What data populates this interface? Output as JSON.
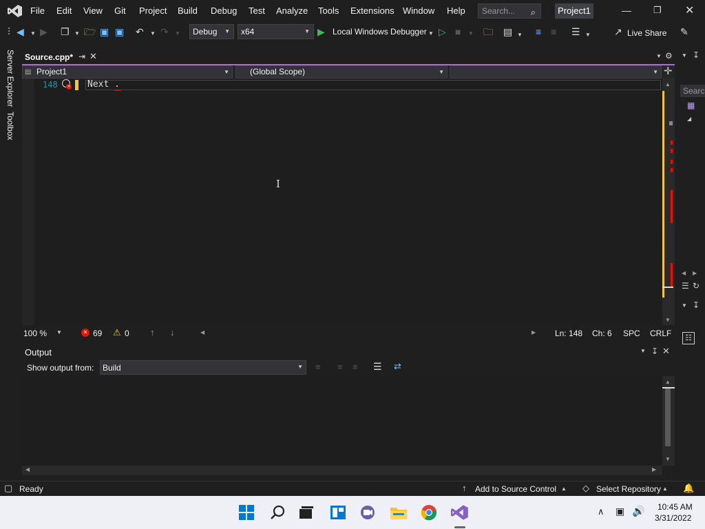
{
  "menu": [
    "File",
    "Edit",
    "View",
    "Git",
    "Project",
    "Build",
    "Debug",
    "Test",
    "Analyze",
    "Tools",
    "Extensions",
    "Window",
    "Help"
  ],
  "search": {
    "placeholder": "Search..."
  },
  "project_title": "Project1",
  "toolbar": {
    "configuration": "Debug",
    "platform": "x64",
    "run_label": "Local Windows Debugger",
    "live_share": "Live Share"
  },
  "side_tabs": {
    "server_explorer": "Server Explorer",
    "toolbox": "Toolbox"
  },
  "document_tab": {
    "name": "Source.cpp*"
  },
  "navbar": {
    "project": "Project1",
    "scope": "(Global Scope)",
    "member": ""
  },
  "editor": {
    "line_number": "148",
    "code": "Next ."
  },
  "editor_status": {
    "zoom": "100 %",
    "errors": "69",
    "warnings": "0",
    "line": "Ln: 148",
    "col": "Ch: 6",
    "spc": "SPC",
    "eol": "CRLF"
  },
  "output": {
    "title": "Output",
    "show_from_label": "Show output from:",
    "source": "Build"
  },
  "right_rail": {
    "search_text": "Searc"
  },
  "statusbar": {
    "ready": "Ready",
    "add_source": "Add to Source Control",
    "select_repo": "Select Repository"
  },
  "taskbar": {
    "time": "10:45 AM",
    "date": "3/31/2022"
  },
  "colors": {
    "accent": "#a56ee6",
    "run_green": "#3fb950",
    "error_red": "#e51400",
    "warning_yellow": "#f6c343"
  }
}
